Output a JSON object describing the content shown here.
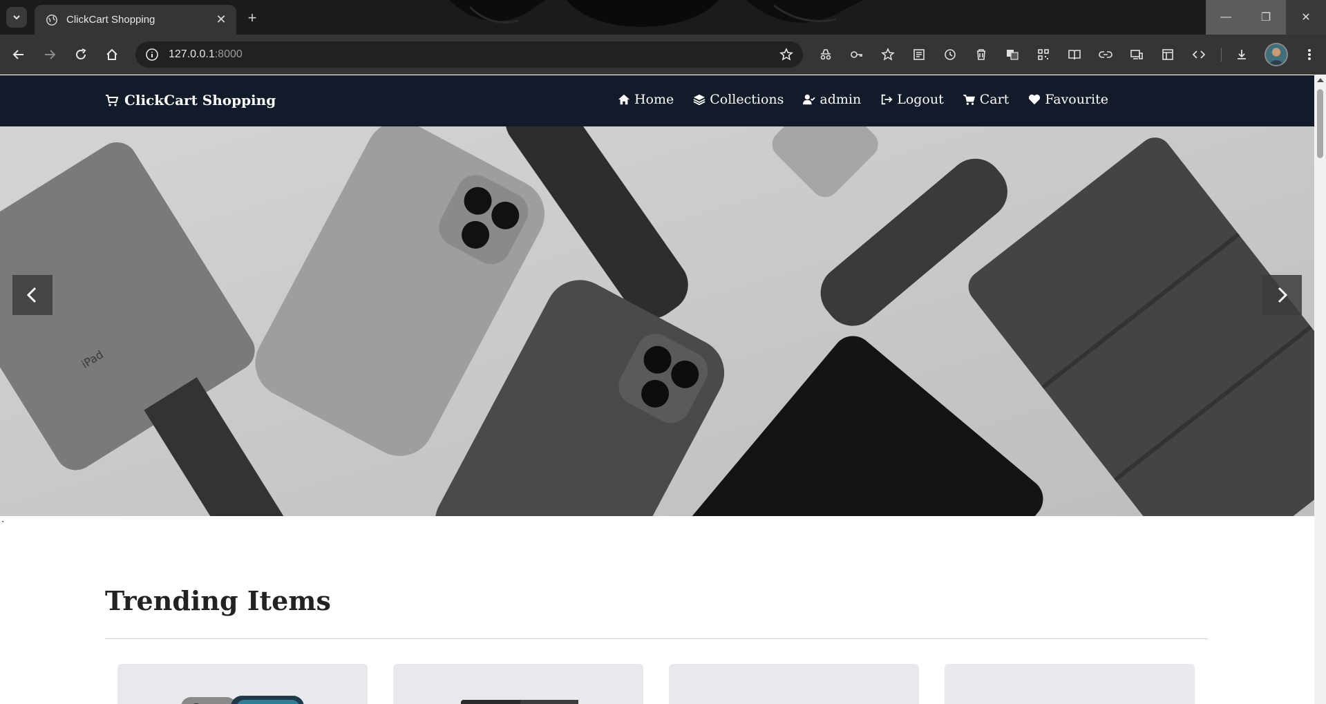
{
  "browser": {
    "tab_title": "ClickCart Shopping",
    "url_host": "127.0.0.1",
    "url_port": ":8000",
    "new_tab_symbol": "+",
    "close_tab_symbol": "✕",
    "window_controls": {
      "minimize": "—",
      "restore": "❐",
      "close": "✕"
    },
    "extensions": [
      "incognito-icon",
      "key-icon",
      "bookmark-star-icon",
      "reading-list-icon",
      "history-icon",
      "trash-icon",
      "translate-icon",
      "qr-code-icon",
      "reader-mode-icon",
      "link-icon",
      "devices-icon",
      "layout-icon",
      "devtools-icon",
      "download-icon"
    ]
  },
  "site": {
    "brand": "ClickCart Shopping",
    "nav": [
      {
        "label": "Home",
        "icon": "home-icon"
      },
      {
        "label": "Collections",
        "icon": "layers-icon"
      },
      {
        "label": "admin",
        "icon": "user-check-icon"
      },
      {
        "label": "Logout",
        "icon": "logout-icon"
      },
      {
        "label": "Cart",
        "icon": "cart-icon"
      },
      {
        "label": "Favourite",
        "icon": "heart-icon"
      }
    ],
    "nav_color": "#131a2a"
  },
  "hero": {
    "prev_icon": "chevron-left-icon",
    "next_icon": "chevron-right-icon",
    "ipad_engraving": "iPad"
  },
  "stray_mark": "`",
  "trending": {
    "title": "Trending Items"
  }
}
